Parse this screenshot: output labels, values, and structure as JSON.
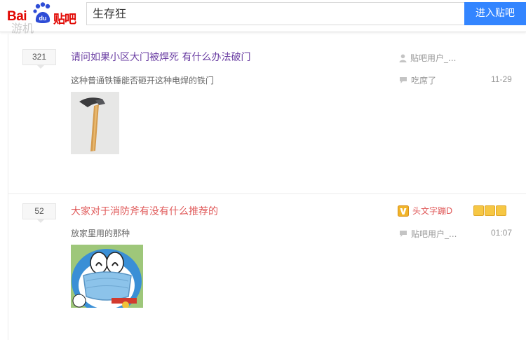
{
  "header": {
    "logo": {
      "bai": "Bai",
      "du": "du",
      "tieba": "贴吧",
      "watermark": "游机"
    },
    "search": {
      "query": "生存狂"
    },
    "enter_button": "进入贴吧"
  },
  "threads": [
    {
      "reply_count": "321",
      "title": "请问如果小区大门被焊死 有什么办法破门",
      "excerpt": "这种普通铁锤能否砸开这种电焊的铁门",
      "author": "贴吧用户_...",
      "last_replier": "吃席了",
      "time": "11-29",
      "image": "hammer",
      "title_color": "#6b3fa3"
    },
    {
      "reply_count": "52",
      "title": "大家对于消防斧有没有什么推荐的",
      "excerpt": "放家里用的那种",
      "author": "头文字蹦D",
      "last_replier": "贴吧用户_...",
      "time": "01:07",
      "image": "doraemon-with-mask",
      "title_color": "#e05a5a"
    }
  ],
  "icons": {
    "user": "user-icon",
    "reply": "reply-bubble-icon",
    "vip": "vip-badge-icon"
  },
  "colors": {
    "brand_red": "#e10601",
    "brand_blue": "#2e4cd6",
    "button_blue": "#3385ff"
  }
}
